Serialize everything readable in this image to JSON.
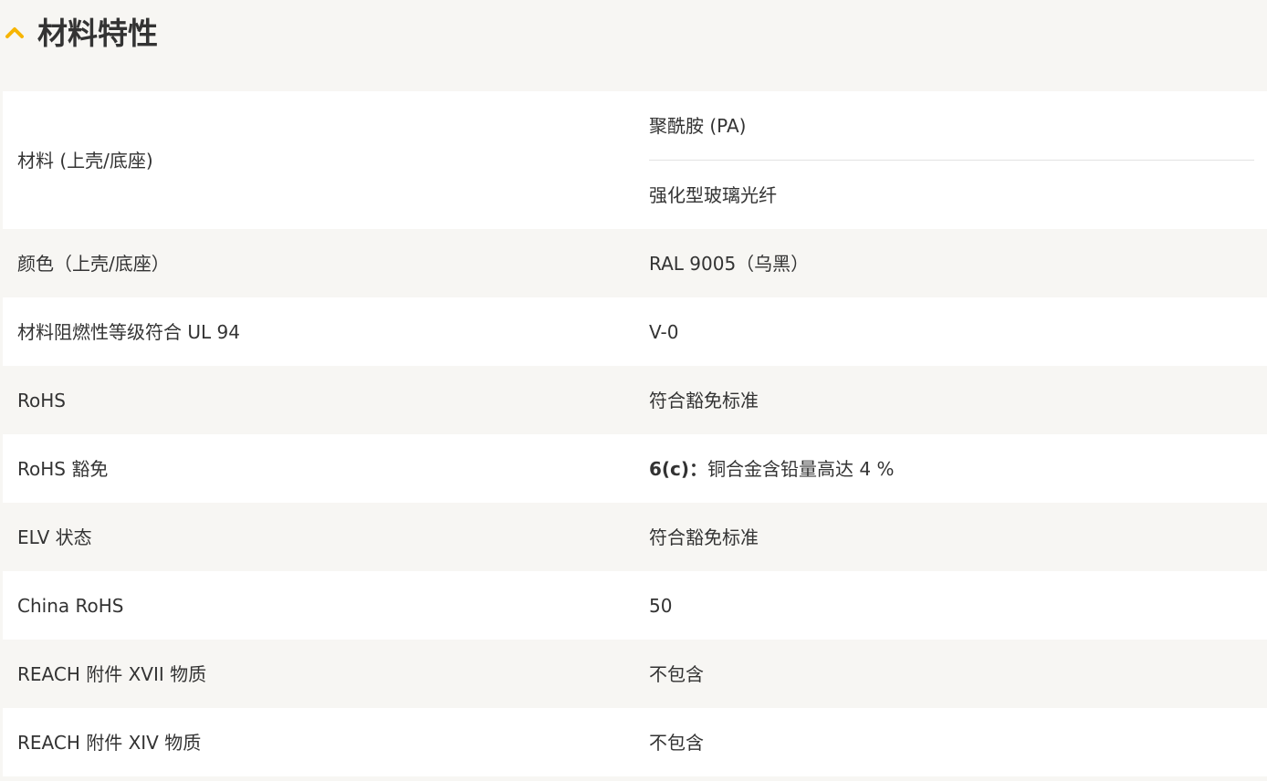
{
  "section": {
    "icon": "chevron-up-icon",
    "accent_color": "#f7b500",
    "title": "材料特性"
  },
  "rows": [
    {
      "label": "材料 (上壳/底座)",
      "values": [
        "聚酰胺 (PA)",
        "强化型玻璃光纤"
      ]
    },
    {
      "label": "颜色（上壳/底座）",
      "value": "RAL 9005（乌黑）"
    },
    {
      "label": "材料阻燃性等级符合 UL 94",
      "value": "V-0"
    },
    {
      "label": "RoHS",
      "value": "符合豁免标准"
    },
    {
      "label": "RoHS 豁免",
      "value_bold": "6(c)：",
      "value_rest": "铜合金含铅量高达 4 %"
    },
    {
      "label": "ELV 状态",
      "value": "符合豁免标准"
    },
    {
      "label": "China RoHS",
      "value": "50"
    },
    {
      "label": "REACH 附件 XVII 物质",
      "value": "不包含"
    },
    {
      "label": "REACH 附件 XIV 物质",
      "value": "不包含"
    }
  ]
}
